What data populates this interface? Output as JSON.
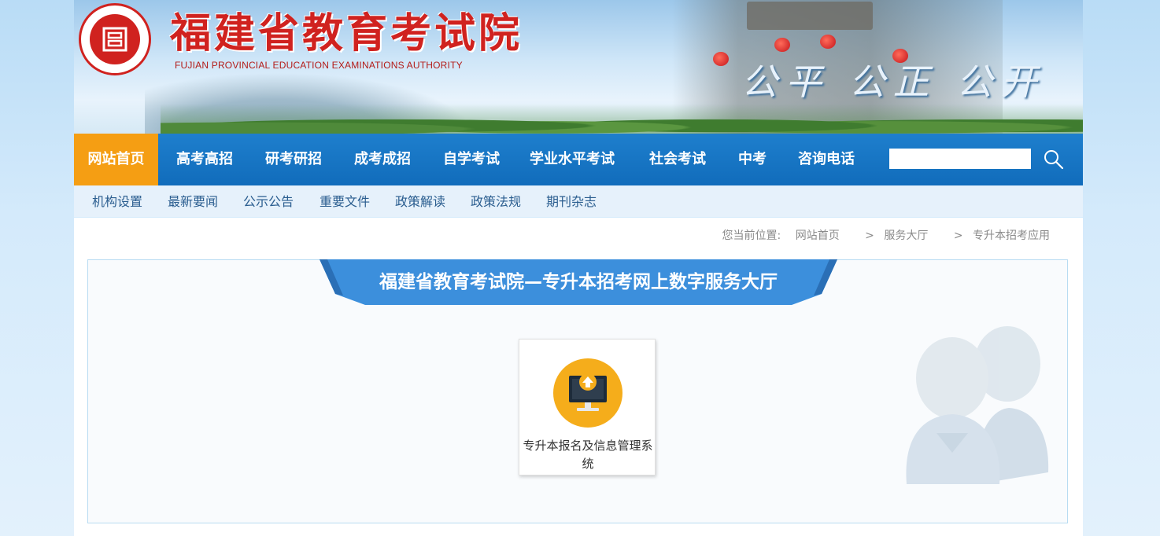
{
  "header": {
    "title": "福建省教育考试院",
    "subtitle": "FUJIAN PROVINCIAL EDUCATION EXAMINATIONS AUTHORITY",
    "slogan": "公平 公正 公开",
    "logo_icon": "seal-logo-icon"
  },
  "nav": {
    "items": [
      {
        "label": "网站首页",
        "active": true
      },
      {
        "label": "高考高招"
      },
      {
        "label": "研考研招"
      },
      {
        "label": "成考成招"
      },
      {
        "label": "自学考试"
      },
      {
        "label": "学业水平考试"
      },
      {
        "label": "社会考试"
      },
      {
        "label": "中考"
      },
      {
        "label": "咨询电话"
      }
    ],
    "search": {
      "value": "",
      "placeholder": "",
      "icon": "search-icon"
    }
  },
  "subnav": {
    "items": [
      "机构设置",
      "最新要闻",
      "公示公告",
      "重要文件",
      "政策解读",
      "政策法规",
      "期刊杂志"
    ]
  },
  "breadcrumb": {
    "prefix": "您当前位置:",
    "items": [
      "网站首页",
      "服务大厅",
      "专升本招考应用"
    ],
    "separator": ">"
  },
  "panel": {
    "title": "福建省教育考试院—专升本招考网上数字服务大厅",
    "services": [
      {
        "label": "专升本报名及信息管理系统",
        "icon": "computer-upload-icon"
      }
    ]
  },
  "colors": {
    "nav_bg": "#1673c3",
    "nav_active": "#f59e13",
    "ribbon": "#3c8fdc",
    "brand_red": "#d0221f",
    "service_icon": "#f5ad1b"
  }
}
